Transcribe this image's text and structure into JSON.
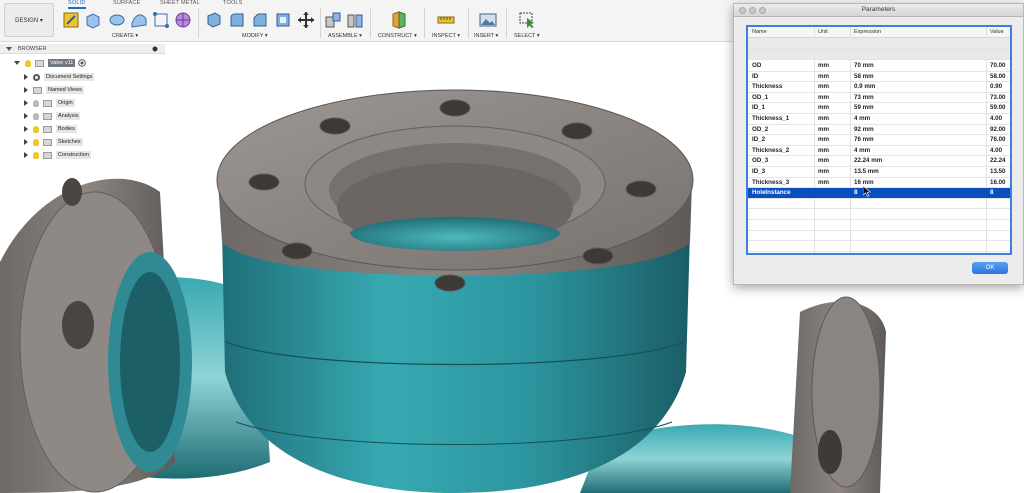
{
  "toolbar": {
    "design_label": "DESIGN ▾",
    "tabs": [
      "SOLID",
      "SURFACE",
      "SHEET METAL",
      "TOOLS"
    ],
    "groups": [
      "CREATE ▾",
      "MODIFY ▾",
      "ASSEMBLE ▾",
      "CONSTRUCT ▾",
      "INSPECT ▾",
      "INSERT ▾",
      "SELECT ▾"
    ]
  },
  "browser": {
    "title": "BROWSER",
    "root": "Valve v11",
    "items": [
      "Document Settings",
      "Named Views",
      "Origin",
      "Analysis",
      "Bodies",
      "Sketches",
      "Construction"
    ]
  },
  "parameters": {
    "title": "Parameters",
    "columns": [
      "Name",
      "Unit",
      "Expression",
      "Value"
    ],
    "rows": [
      {
        "name": "OD",
        "unit": "mm",
        "expression": "70 mm",
        "value": "70.00"
      },
      {
        "name": "ID",
        "unit": "mm",
        "expression": "58 mm",
        "value": "58.00"
      },
      {
        "name": "Thickness",
        "unit": "mm",
        "expression": "0.9 mm",
        "value": "0.90"
      },
      {
        "name": "OD_1",
        "unit": "mm",
        "expression": "73 mm",
        "value": "73.00"
      },
      {
        "name": "ID_1",
        "unit": "mm",
        "expression": "59 mm",
        "value": "59.00"
      },
      {
        "name": "Thickness_1",
        "unit": "mm",
        "expression": "4 mm",
        "value": "4.00"
      },
      {
        "name": "OD_2",
        "unit": "mm",
        "expression": "92 mm",
        "value": "92.00"
      },
      {
        "name": "ID_2",
        "unit": "mm",
        "expression": "76 mm",
        "value": "76.00"
      },
      {
        "name": "Thickness_2",
        "unit": "mm",
        "expression": "4 mm",
        "value": "4.00"
      },
      {
        "name": "OD_3",
        "unit": "mm",
        "expression": "22.24 mm",
        "value": "22.24"
      },
      {
        "name": "ID_3",
        "unit": "mm",
        "expression": "13.5 mm",
        "value": "13.50"
      },
      {
        "name": "Thickness_3",
        "unit": "mm",
        "expression": "16 mm",
        "value": "16.00"
      },
      {
        "name": "HoleInstance",
        "unit": "",
        "expression": "8",
        "value": "8"
      }
    ],
    "ok_label": "OK"
  },
  "colors": {
    "accent": "#1a6fc2",
    "selection": "#0a4fc0",
    "body_teal": "#2a8f98",
    "flange_gray": "#8a8480"
  }
}
